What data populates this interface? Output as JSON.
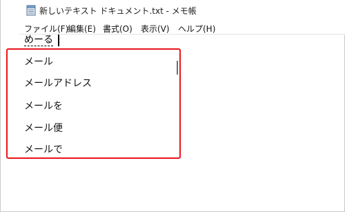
{
  "window": {
    "title": "新しいテキスト ドキュメント.txt - メモ帳"
  },
  "menu": [
    {
      "label": "ファイル(F)"
    },
    {
      "label": "編集(E)"
    },
    {
      "label": "書式(O)"
    },
    {
      "label": "表示(V)"
    },
    {
      "label": "ヘルプ(H)"
    }
  ],
  "editor": {
    "composition_text": "めーる"
  },
  "ime": {
    "candidates": [
      {
        "label": "メール"
      },
      {
        "label": "メールアドレス"
      },
      {
        "label": "メールを"
      },
      {
        "label": "メール便"
      },
      {
        "label": "メールで"
      }
    ],
    "highlight_color": "#e8141c"
  },
  "icons": {
    "app": "notepad-icon"
  }
}
